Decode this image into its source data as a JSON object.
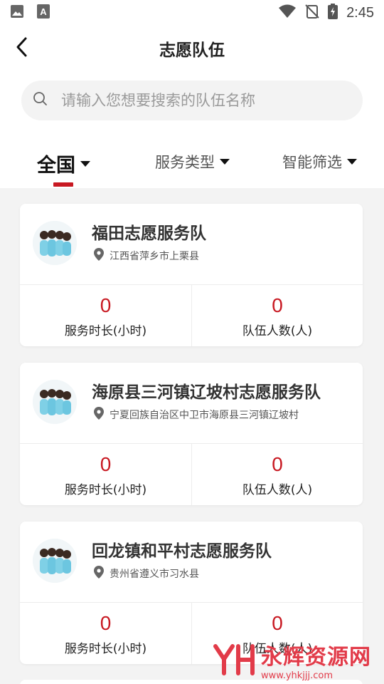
{
  "status_bar": {
    "time": "2:45"
  },
  "header": {
    "title": "志愿队伍"
  },
  "search": {
    "placeholder": "请输入您想要搜索的队伍名称"
  },
  "filters": [
    {
      "label": "全国",
      "active": true
    },
    {
      "label": "服务类型",
      "active": false
    },
    {
      "label": "智能筛选",
      "active": false
    }
  ],
  "teams": [
    {
      "name": "福田志愿服务队",
      "location": "江西省萍乡市上栗县",
      "service_hours": "0",
      "service_hours_label": "服务时长(小时)",
      "member_count": "0",
      "member_count_label": "队伍人数(人)"
    },
    {
      "name": "海原县三河镇辽坡村志愿服务队",
      "location": "宁夏回族自治区中卫市海原县三河镇辽坡村",
      "service_hours": "0",
      "service_hours_label": "服务时长(小时)",
      "member_count": "0",
      "member_count_label": "队伍人数(人)"
    },
    {
      "name": "回龙镇和平村志愿服务队",
      "location": "贵州省遵义市习水县",
      "service_hours": "0",
      "service_hours_label": "服务时长(小时)",
      "member_count": "0",
      "member_count_label": "队伍人数(人)"
    }
  ],
  "watermark": {
    "text": "永辉资源网",
    "url": "www.yhkjjj.com"
  },
  "colors": {
    "accent": "#c81922",
    "background": "#f3f3f3"
  }
}
